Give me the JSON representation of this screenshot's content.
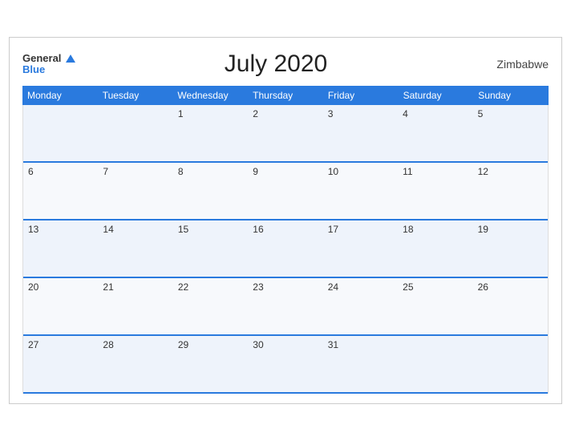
{
  "calendar": {
    "title": "July 2020",
    "country": "Zimbabwe",
    "logo": {
      "general": "General",
      "blue": "Blue"
    },
    "days": [
      "Monday",
      "Tuesday",
      "Wednesday",
      "Thursday",
      "Friday",
      "Saturday",
      "Sunday"
    ],
    "weeks": [
      [
        null,
        null,
        null,
        1,
        2,
        3,
        4,
        5
      ],
      [
        6,
        7,
        8,
        9,
        10,
        11,
        12
      ],
      [
        13,
        14,
        15,
        16,
        17,
        18,
        19
      ],
      [
        20,
        21,
        22,
        23,
        24,
        25,
        26
      ],
      [
        27,
        28,
        29,
        30,
        31,
        null,
        null
      ]
    ]
  }
}
